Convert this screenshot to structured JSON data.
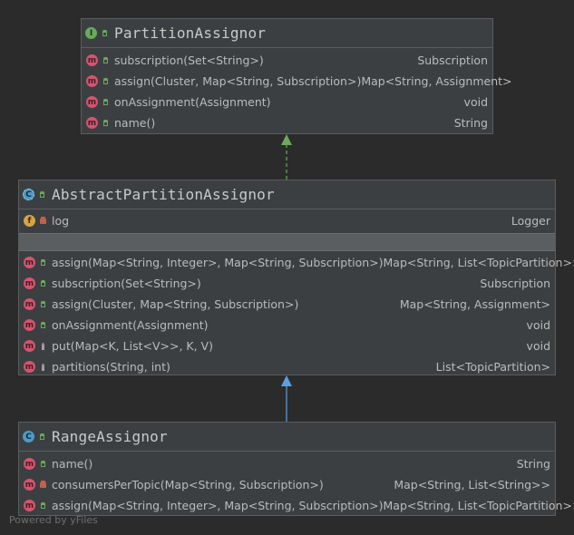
{
  "partition_assignor": {
    "title": "PartitionAssignor",
    "icon": "interface-icon",
    "methods": [
      {
        "name": "subscription(Set<String>)",
        "type": "Subscription"
      },
      {
        "name": "assign(Cluster, Map<String, Subscription>)",
        "type": "Map<String, Assignment>"
      },
      {
        "name": "onAssignment(Assignment)",
        "type": "void"
      },
      {
        "name": "name()",
        "type": "String"
      }
    ]
  },
  "abstract_partition_assignor": {
    "title": "AbstractPartitionAssignor",
    "icon": "abstract-class-icon",
    "fields": [
      {
        "name": "log",
        "type": "Logger"
      }
    ],
    "methods": [
      {
        "name": "assign(Map<String, Integer>, Map<String, Subscription>)",
        "type": "Map<String, List<TopicPartition>>"
      },
      {
        "name": "subscription(Set<String>)",
        "type": "Subscription"
      },
      {
        "name": "assign(Cluster, Map<String, Subscription>)",
        "type": "Map<String, Assignment>"
      },
      {
        "name": "onAssignment(Assignment)",
        "type": "void"
      },
      {
        "name": "put(Map<K, List<V>>, K, V)",
        "type": "void"
      },
      {
        "name": "partitions(String, int)",
        "type": "List<TopicPartition>"
      }
    ]
  },
  "range_assignor": {
    "title": "RangeAssignor",
    "icon": "class-icon",
    "methods": [
      {
        "name": "name()",
        "type": "String"
      },
      {
        "name": "consumersPerTopic(Map<String, Subscription>)",
        "type": "Map<String, List<String>>"
      },
      {
        "name": "assign(Map<String, Integer>, Map<String, Subscription>)",
        "type": "Map<String, List<TopicPartition>>"
      }
    ]
  },
  "footer": "Powered by yFiles",
  "colors": {
    "background": "#2b2b2b",
    "box": "#3c3f41",
    "realization_arrow": "#6aab5a",
    "inheritance_arrow": "#5c9fdc"
  }
}
